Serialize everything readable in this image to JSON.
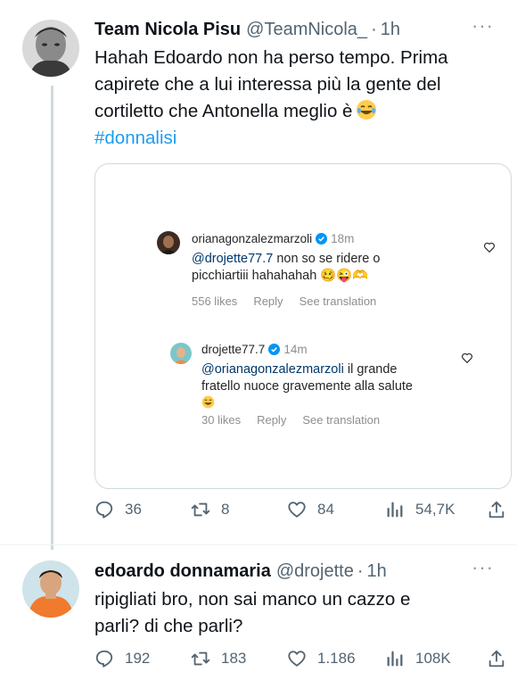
{
  "tweet1": {
    "display_name": "Team Nicola Pisu",
    "handle": "@TeamNicola_",
    "separator": "·",
    "time": "1h",
    "line1": "Hahah Edoardo non ha perso tempo. Prima",
    "line2": "capirete che a lui interessa più la gente del",
    "line3": "cortiletto che Antonella meglio è",
    "hashtag": "#donnalisi",
    "embedded": {
      "comment1": {
        "username": "orianagonzalezmarzoli",
        "time": "18m",
        "mention": "@drojette77.7",
        "text_a": " non so se ridere o",
        "text_b": "picchiartiii hahahahah",
        "emoji": "🥴😜🫶",
        "likes": "556 likes",
        "reply": "Reply",
        "translate": "See translation"
      },
      "comment2": {
        "username": "drojette77.7",
        "time": "14m",
        "mention": "@orianagonzalezmarzoli",
        "text_a": " il grande",
        "text_b": "fratello nuoce gravemente alla salute",
        "likes": "30 likes",
        "reply": "Reply",
        "translate": "See translation"
      }
    },
    "stats": {
      "replies": "36",
      "retweets": "8",
      "likes": "84",
      "views": "54,7K"
    }
  },
  "tweet2": {
    "display_name": "edoardo donnamaria",
    "handle": "@drojette",
    "separator": "·",
    "time": "1h",
    "line1": "ripigliati bro, non sai manco un cazzo e",
    "line2": "parli? di che parli?",
    "stats": {
      "replies": "192",
      "retweets": "183",
      "likes": "1.186",
      "views": "108K"
    }
  },
  "colors": {
    "link": "#1d9bf0",
    "muted": "#536471",
    "ig_mention": "#00376b",
    "ig_verified": "#0095f6"
  },
  "icons": [
    "reply-icon",
    "retweet-icon",
    "like-icon",
    "views-icon",
    "share-icon",
    "more-icon",
    "verified-icon",
    "heart-outline-icon"
  ]
}
